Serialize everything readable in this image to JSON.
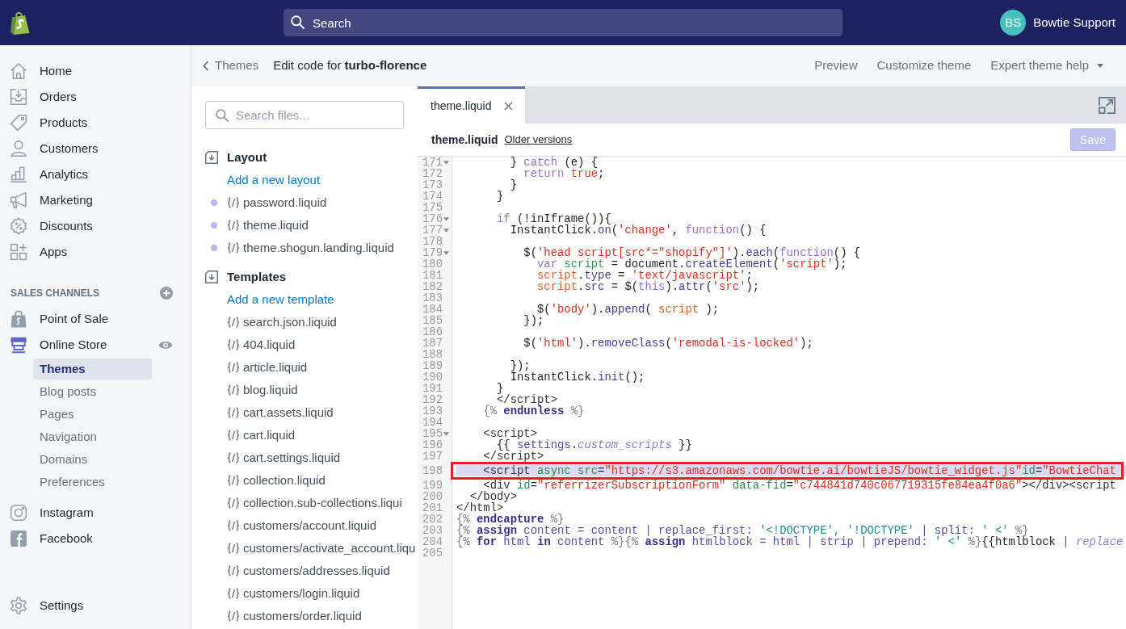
{
  "top_bar": {
    "search": {
      "placeholder": "Search"
    },
    "account": {
      "initials": "BS",
      "name": "Bowtie Support"
    }
  },
  "sidebar": {
    "items": [
      {
        "label": "Home",
        "selected": false
      },
      {
        "label": "Orders",
        "selected": false
      },
      {
        "label": "Products",
        "selected": false
      },
      {
        "label": "Customers",
        "selected": false
      },
      {
        "label": "Analytics",
        "selected": false
      },
      {
        "label": "Marketing",
        "selected": false
      },
      {
        "label": "Discounts",
        "selected": false
      },
      {
        "label": "Apps",
        "selected": false
      }
    ],
    "sales_channels": {
      "heading": "SALES CHANNELS",
      "items": [
        {
          "label": "Point of Sale",
          "selected": false,
          "view_button": false
        },
        {
          "label": "Online Store",
          "selected": true,
          "view_button": true,
          "children": [
            {
              "label": "Themes",
              "selected": true
            },
            {
              "label": "Blog posts",
              "selected": false
            },
            {
              "label": "Pages",
              "selected": false
            },
            {
              "label": "Navigation",
              "selected": false
            },
            {
              "label": "Domains",
              "selected": false
            },
            {
              "label": "Preferences",
              "selected": false
            }
          ]
        },
        {
          "label": "Instagram",
          "selected": false,
          "view_button": false
        },
        {
          "label": "Facebook",
          "selected": false,
          "view_button": false
        }
      ]
    },
    "settings": {
      "label": "Settings"
    }
  },
  "page_header": {
    "back_link": "Themes",
    "title": "Edit code for **turbo-florence**",
    "links": [
      {
        "label": "Preview",
        "kind": "link"
      },
      {
        "label": "Customize theme",
        "kind": "link"
      },
      {
        "label": "Expert theme help",
        "kind": "menu"
      }
    ]
  },
  "file_browser": {
    "search": {
      "placeholder": "Search files..."
    },
    "sections": [
      {
        "title": "Layout",
        "add_link": "Add a new layout",
        "files": [
          {
            "name": "password.liquid",
            "marked": true
          },
          {
            "name": "theme.liquid",
            "marked": true
          },
          {
            "name": "theme.shogun.landing.liquid",
            "marked": true
          }
        ]
      },
      {
        "title": "Templates",
        "add_link": "Add a new template",
        "files": [
          {
            "name": "search.json.liquid",
            "marked": false
          },
          {
            "name": "404.liquid",
            "marked": false
          },
          {
            "name": "article.liquid",
            "marked": false
          },
          {
            "name": "blog.liquid",
            "marked": false
          },
          {
            "name": "cart.assets.liquid",
            "marked": false
          },
          {
            "name": "cart.liquid",
            "marked": false
          },
          {
            "name": "cart.settings.liquid",
            "marked": false
          },
          {
            "name": "collection.liquid",
            "marked": false
          },
          {
            "name": "collection.sub-collections.liqui",
            "marked": false
          },
          {
            "name": "customers/account.liquid",
            "marked": false
          },
          {
            "name": "customers/activate_account.liqu",
            "marked": false
          },
          {
            "name": "customers/addresses.liquid",
            "marked": false
          },
          {
            "name": "customers/login.liquid",
            "marked": false
          },
          {
            "name": "customers/order.liquid",
            "marked": false
          }
        ]
      }
    ]
  },
  "editor": {
    "tabs": [
      {
        "label": "theme.liquid",
        "selected": true
      }
    ],
    "file_title": "theme.liquid",
    "history_link": "Older versions",
    "save_button": {
      "label": "Save",
      "disabled": true
    },
    "lines": [
      {
        "number": "171",
        "foldable": true,
        "selected": false,
        "framed": false,
        "tokens": [
          {
            "kind": "plain",
            "text": "        } "
          },
          {
            "kind": "keyword",
            "text": "catch"
          },
          {
            "kind": "plain",
            "text": " (e) {"
          }
        ]
      },
      {
        "number": "172",
        "foldable": false,
        "selected": false,
        "framed": false,
        "tokens": [
          {
            "kind": "keyword",
            "text": "          return "
          },
          {
            "kind": "atom",
            "text": "true"
          },
          {
            "kind": "plain",
            "text": ";"
          }
        ]
      },
      {
        "number": "173",
        "foldable": false,
        "selected": false,
        "framed": false,
        "tokens": [
          {
            "kind": "plain",
            "text": "        }"
          }
        ]
      },
      {
        "number": "174",
        "foldable": false,
        "selected": false,
        "framed": false,
        "tokens": [
          {
            "kind": "plain",
            "text": "      }"
          }
        ]
      },
      {
        "number": "175",
        "foldable": false,
        "selected": false,
        "framed": false
      },
      {
        "number": "176",
        "foldable": true,
        "selected": false,
        "framed": false,
        "tokens": [
          {
            "kind": "keyword",
            "text": "      if"
          },
          {
            "kind": "plain",
            "text": " (!inIframe()){"
          }
        ]
      },
      {
        "number": "177",
        "foldable": true,
        "selected": false,
        "framed": false,
        "tokens": [
          {
            "kind": "plain",
            "text": "        InstantClick."
          },
          {
            "kind": "property",
            "text": "on"
          },
          {
            "kind": "plain",
            "text": "("
          },
          {
            "kind": "string",
            "text": "'change'"
          },
          {
            "kind": "plain",
            "text": ", "
          },
          {
            "kind": "keyword",
            "text": "function"
          },
          {
            "kind": "plain",
            "text": "() {"
          }
        ]
      },
      {
        "number": "178",
        "foldable": false,
        "selected": false,
        "framed": false
      },
      {
        "number": "179",
        "foldable": true,
        "selected": false,
        "framed": false,
        "tokens": [
          {
            "kind": "plain",
            "text": "          $("
          },
          {
            "kind": "string",
            "text": "'head script[src*=\"shopify\"]'"
          },
          {
            "kind": "plain",
            "text": ")."
          },
          {
            "kind": "property",
            "text": "each"
          },
          {
            "kind": "plain",
            "text": "("
          },
          {
            "kind": "keyword",
            "text": "function"
          },
          {
            "kind": "plain",
            "text": "() {"
          }
        ]
      },
      {
        "number": "180",
        "foldable": false,
        "selected": false,
        "framed": false,
        "tokens": [
          {
            "kind": "keyword",
            "text": "            var "
          },
          {
            "kind": "def",
            "text": "script"
          },
          {
            "kind": "plain",
            "text": " = document."
          },
          {
            "kind": "property",
            "text": "createElement"
          },
          {
            "kind": "plain",
            "text": "("
          },
          {
            "kind": "string",
            "text": "'script'"
          },
          {
            "kind": "plain",
            "text": ");"
          }
        ]
      },
      {
        "number": "181",
        "foldable": false,
        "selected": false,
        "framed": false,
        "tokens": [
          {
            "kind": "variable",
            "text": "            script"
          },
          {
            "kind": "plain",
            "text": "."
          },
          {
            "kind": "property",
            "text": "type"
          },
          {
            "kind": "plain",
            "text": " = "
          },
          {
            "kind": "string",
            "text": "'text/javascript'"
          },
          {
            "kind": "plain",
            "text": ";"
          }
        ]
      },
      {
        "number": "182",
        "foldable": false,
        "selected": false,
        "framed": false,
        "tokens": [
          {
            "kind": "variable",
            "text": "            script"
          },
          {
            "kind": "plain",
            "text": "."
          },
          {
            "kind": "property",
            "text": "src"
          },
          {
            "kind": "plain",
            "text": " = $("
          },
          {
            "kind": "keyword",
            "text": "this"
          },
          {
            "kind": "plain",
            "text": ")."
          },
          {
            "kind": "property",
            "text": "attr"
          },
          {
            "kind": "plain",
            "text": "("
          },
          {
            "kind": "string",
            "text": "'src'"
          },
          {
            "kind": "plain",
            "text": ");"
          }
        ]
      },
      {
        "number": "183",
        "foldable": false,
        "selected": false,
        "framed": false
      },
      {
        "number": "184",
        "foldable": false,
        "selected": false,
        "framed": false,
        "tokens": [
          {
            "kind": "plain",
            "text": "            $("
          },
          {
            "kind": "string",
            "text": "'body'"
          },
          {
            "kind": "plain",
            "text": ")."
          },
          {
            "kind": "property",
            "text": "append"
          },
          {
            "kind": "plain",
            "text": "( "
          },
          {
            "kind": "variable",
            "text": "script"
          },
          {
            "kind": "plain",
            "text": " );"
          }
        ]
      },
      {
        "number": "185",
        "foldable": false,
        "selected": false,
        "framed": false,
        "tokens": [
          {
            "kind": "plain",
            "text": "          });"
          }
        ]
      },
      {
        "number": "186",
        "foldable": false,
        "selected": false,
        "framed": false
      },
      {
        "number": "187",
        "foldable": false,
        "selected": false,
        "framed": false,
        "tokens": [
          {
            "kind": "plain",
            "text": "          $("
          },
          {
            "kind": "string",
            "text": "'html'"
          },
          {
            "kind": "plain",
            "text": ")."
          },
          {
            "kind": "property",
            "text": "removeClass"
          },
          {
            "kind": "plain",
            "text": "("
          },
          {
            "kind": "string",
            "text": "'remodal-is-locked'"
          },
          {
            "kind": "plain",
            "text": ");"
          }
        ]
      },
      {
        "number": "188",
        "foldable": false,
        "selected": false,
        "framed": false
      },
      {
        "number": "189",
        "foldable": false,
        "selected": false,
        "framed": false,
        "tokens": [
          {
            "kind": "plain",
            "text": "        });"
          }
        ]
      },
      {
        "number": "190",
        "foldable": false,
        "selected": false,
        "framed": false,
        "tokens": [
          {
            "kind": "plain",
            "text": "        InstantClick."
          },
          {
            "kind": "property",
            "text": "init"
          },
          {
            "kind": "plain",
            "text": "();"
          }
        ]
      },
      {
        "number": "191",
        "foldable": false,
        "selected": false,
        "framed": false,
        "tokens": [
          {
            "kind": "plain",
            "text": "      }"
          }
        ]
      },
      {
        "number": "192",
        "foldable": false,
        "selected": false,
        "framed": false,
        "tokens": [
          {
            "kind": "tag",
            "text": "      </script>"
          }
        ]
      },
      {
        "number": "193",
        "foldable": false,
        "selected": false,
        "framed": false,
        "tokens": [
          {
            "kind": "liquid-delim",
            "text": "    {% "
          },
          {
            "kind": "liquid-keyword",
            "text": "endunless"
          },
          {
            "kind": "liquid-delim",
            "text": " %}"
          }
        ]
      },
      {
        "number": "194",
        "foldable": false,
        "selected": false,
        "framed": false
      },
      {
        "number": "195",
        "foldable": true,
        "selected": false,
        "framed": false,
        "tokens": [
          {
            "kind": "tag",
            "text": "    <script>"
          }
        ]
      },
      {
        "number": "196",
        "foldable": false,
        "selected": false,
        "framed": false,
        "tokens": [
          {
            "kind": "plain",
            "text": "      {{ "
          },
          {
            "kind": "liquid",
            "text": "settings"
          },
          {
            "kind": "plain",
            "text": "."
          },
          {
            "kind": "liquid-italic",
            "text": "custom_scripts"
          },
          {
            "kind": "plain",
            "text": " }}"
          }
        ]
      },
      {
        "number": "197",
        "foldable": false,
        "selected": false,
        "framed": false,
        "tokens": [
          {
            "kind": "tag",
            "text": "    </script>"
          }
        ]
      },
      {
        "number": "198",
        "foldable": false,
        "selected": true,
        "framed": true,
        "tokens": [
          {
            "kind": "tag",
            "text": "    <script "
          },
          {
            "kind": "attribute",
            "text": "async src"
          },
          {
            "kind": "plain",
            "text": "="
          },
          {
            "kind": "string",
            "text": "\"https://s3.amazonaws.com/bowtie.ai/bowtieJS/bowtie_widget.js\""
          },
          {
            "kind": "attribute",
            "text": "id"
          },
          {
            "kind": "plain",
            "text": "="
          },
          {
            "kind": "string",
            "text": "\"BowtieChat"
          }
        ]
      },
      {
        "number": "199",
        "foldable": false,
        "selected": false,
        "framed": false,
        "tokens": [
          {
            "kind": "tag",
            "text": "    <div "
          },
          {
            "kind": "attribute",
            "text": "id"
          },
          {
            "kind": "plain",
            "text": "="
          },
          {
            "kind": "string",
            "text": "\"referrizerSubscriptionForm\" "
          },
          {
            "kind": "attribute",
            "text": "data-fid"
          },
          {
            "kind": "plain",
            "text": "="
          },
          {
            "kind": "string",
            "text": "\"c744841d740c067719315fe84ea4f0a6\""
          },
          {
            "kind": "tag",
            "text": "></div><script"
          }
        ]
      },
      {
        "number": "200",
        "foldable": false,
        "selected": false,
        "framed": false,
        "tokens": [
          {
            "kind": "tag",
            "text": "  </body>"
          }
        ]
      },
      {
        "number": "201",
        "foldable": false,
        "selected": false,
        "framed": false,
        "tokens": [
          {
            "kind": "tag",
            "text": "</html>"
          }
        ]
      },
      {
        "number": "202",
        "foldable": false,
        "selected": false,
        "framed": false,
        "tokens": [
          {
            "kind": "liquid-delim",
            "text": "{% "
          },
          {
            "kind": "liquid-keyword",
            "text": "endcapture"
          },
          {
            "kind": "liquid-delim",
            "text": " %}"
          }
        ]
      },
      {
        "number": "203",
        "foldable": false,
        "selected": false,
        "framed": false,
        "tokens": [
          {
            "kind": "liquid-delim",
            "text": "{% "
          },
          {
            "kind": "liquid-keyword",
            "text": "assign"
          },
          {
            "kind": "liquid",
            "text": " content = content | replace_first: "
          },
          {
            "kind": "liquid-string",
            "text": "'<!DOCTYPE', '!DOCTYPE'"
          },
          {
            "kind": "liquid",
            "text": " | split: "
          },
          {
            "kind": "liquid-string",
            "text": "' <'"
          },
          {
            "kind": "liquid-delim",
            "text": " %}"
          }
        ]
      },
      {
        "number": "204",
        "foldable": false,
        "selected": false,
        "framed": false,
        "tokens": [
          {
            "kind": "liquid-delim",
            "text": "{% "
          },
          {
            "kind": "liquid-keyword",
            "text": "for"
          },
          {
            "kind": "liquid",
            "text": " html "
          },
          {
            "kind": "liquid-keyword",
            "text": "in"
          },
          {
            "kind": "liquid",
            "text": " content "
          },
          {
            "kind": "liquid-delim",
            "text": "%}{% "
          },
          {
            "kind": "liquid-keyword",
            "text": "assign"
          },
          {
            "kind": "liquid",
            "text": " htmlblock = html | strip | prepend: "
          },
          {
            "kind": "liquid-string",
            "text": "' <'"
          },
          {
            "kind": "liquid-delim",
            "text": " %}"
          },
          {
            "kind": "plain",
            "text": "{{htmlblock "
          },
          {
            "kind": "liquid",
            "text": "| "
          },
          {
            "kind": "liquid-italic",
            "text": "replace"
          }
        ]
      },
      {
        "number": "205",
        "foldable": false,
        "selected": false,
        "framed": false
      }
    ]
  }
}
